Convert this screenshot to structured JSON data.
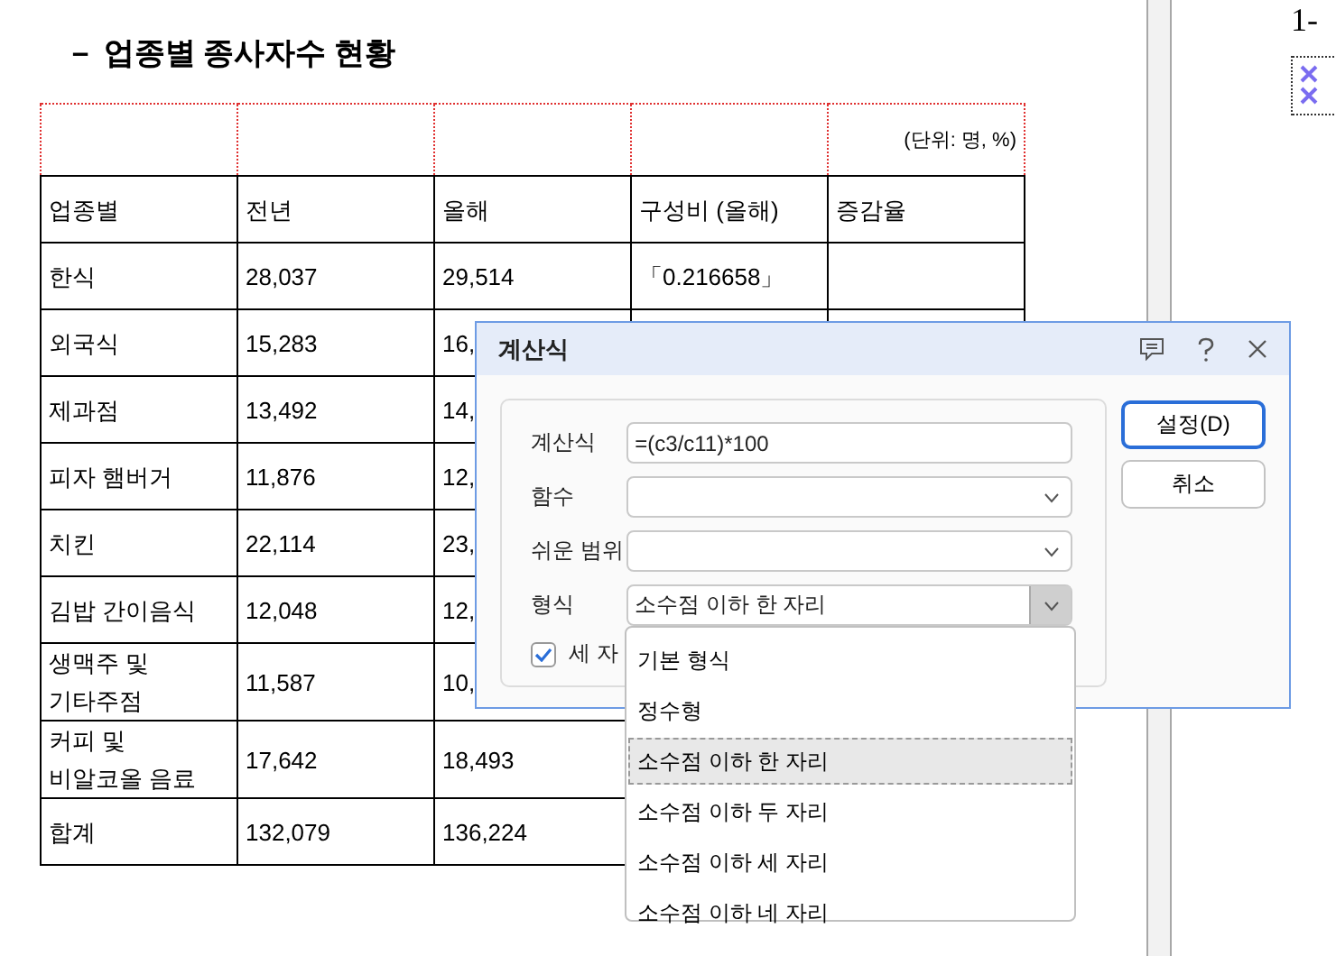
{
  "document": {
    "heading": "－ 업종별 종사자수 현황",
    "unit_note": "(단위:  명,  %)",
    "table": {
      "columns": [
        "업종별",
        "전년",
        "올해",
        "구성비 (올해)",
        "증감율"
      ],
      "rows": [
        {
          "cells": [
            "한식",
            "28,037",
            "29,514",
            "「0.216658」"
          ]
        },
        {
          "cells": [
            "외국식",
            "15,283",
            "16,"
          ]
        },
        {
          "cells": [
            "제과점",
            "13,492",
            "14,"
          ]
        },
        {
          "cells": [
            "피자 햄버거",
            "11,876",
            "12,"
          ]
        },
        {
          "cells": [
            "치킨",
            "22,114",
            "23,"
          ]
        },
        {
          "cells": [
            "김밥 간이음식",
            "12,048",
            "12,"
          ]
        },
        {
          "cells": [
            "생맥주 및\n기타주점",
            "11,587",
            "10,"
          ]
        },
        {
          "cells": [
            "커피 및\n비알코올 음료",
            "17,642",
            "18,493"
          ]
        },
        {
          "cells": [
            "합계",
            "132,079",
            "136,224"
          ]
        }
      ]
    }
  },
  "side_page": {
    "heading": "1-"
  },
  "dialog": {
    "title": "계산식",
    "fields": [
      {
        "kind": "text",
        "label": "계산식",
        "value": "=(c3/c11)*100"
      },
      {
        "kind": "select",
        "label": "함수"
      },
      {
        "kind": "select",
        "label": "쉬운 범위"
      },
      {
        "kind": "select",
        "label": "형식",
        "value": "소수점 이하 한 자리",
        "open": true
      }
    ],
    "checkbox": {
      "label": "세 자",
      "checked": true
    },
    "buttons": [
      {
        "label": "설정(D)",
        "default": true
      },
      {
        "label": "취소",
        "default": false
      }
    ],
    "dropdown": [
      {
        "label": "기본 형식",
        "selected": false
      },
      {
        "label": "정수형",
        "selected": false
      },
      {
        "label": "소수점 이하 한 자리",
        "selected": true
      },
      {
        "label": "소수점 이하 두 자리",
        "selected": false
      },
      {
        "label": "소수점 이하 세 자리",
        "selected": false
      },
      {
        "label": "소수점 이하 네 자리",
        "selected": false
      }
    ]
  }
}
